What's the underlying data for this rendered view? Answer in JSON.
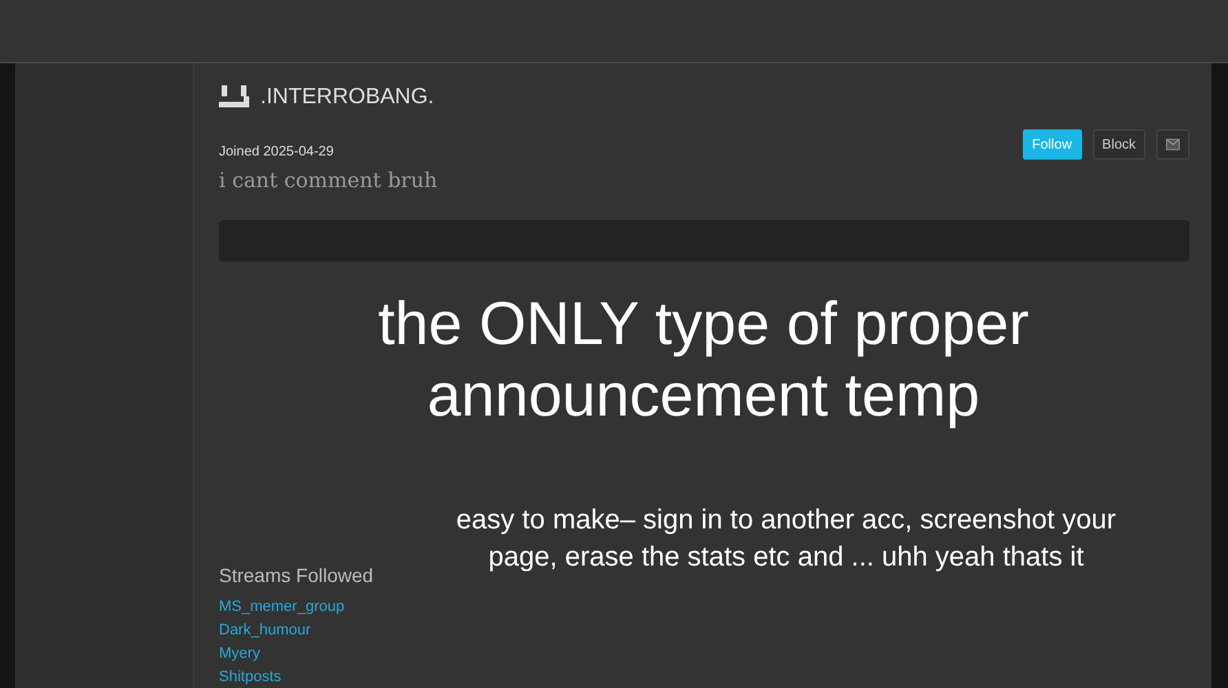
{
  "profile": {
    "username": ".INTERROBANG.",
    "joined": "Joined 2025-04-29",
    "bio": "i cant comment bruh"
  },
  "buttons": [
    {
      "kind": "follow",
      "label": "Follow"
    },
    {
      "kind": "block",
      "label": "Block"
    },
    {
      "kind": "message"
    }
  ],
  "caption": {
    "title": "the ONLY type of proper announcement temp",
    "subtitle": "easy to make– sign in to another acc, screenshot your page, erase the stats etc and ... uhh yeah thats it"
  },
  "streams": {
    "heading": "Streams Followed",
    "items": [
      "MS_memer_group",
      "Dark_humour",
      "Myery",
      "Shitposts"
    ]
  }
}
